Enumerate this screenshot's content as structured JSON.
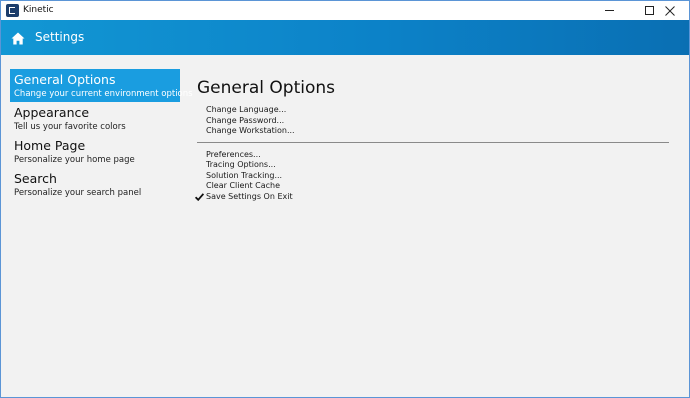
{
  "window": {
    "title": "Kinetic",
    "minimize_icon": "minimize-icon",
    "maximize_icon": "maximize-icon",
    "close_icon": "close-icon"
  },
  "header": {
    "icon": "home-icon",
    "title": "Settings"
  },
  "sidebar": {
    "items": [
      {
        "title": "General Options",
        "subtitle": "Change your current environment options",
        "active": true
      },
      {
        "title": "Appearance",
        "subtitle": "Tell us your favorite colors",
        "active": false
      },
      {
        "title": "Home Page",
        "subtitle": "Personalize your home page",
        "active": false
      },
      {
        "title": "Search",
        "subtitle": "Personalize your search panel",
        "active": false
      }
    ]
  },
  "main": {
    "title": "General Options",
    "group1": [
      "Change Language...",
      "Change Password...",
      "Change Workstation..."
    ],
    "group2": [
      {
        "label": "Preferences...",
        "checked": false
      },
      {
        "label": "Tracing Options...",
        "checked": false
      },
      {
        "label": "Solution Tracking...",
        "checked": false
      },
      {
        "label": "Clear Client Cache",
        "checked": false
      },
      {
        "label": "Save Settings On Exit",
        "checked": true
      }
    ]
  },
  "colors": {
    "header_start": "#1297d4",
    "header_end": "#0a6fb3",
    "active_item": "#1a9de0",
    "background": "#f2f2f2"
  }
}
